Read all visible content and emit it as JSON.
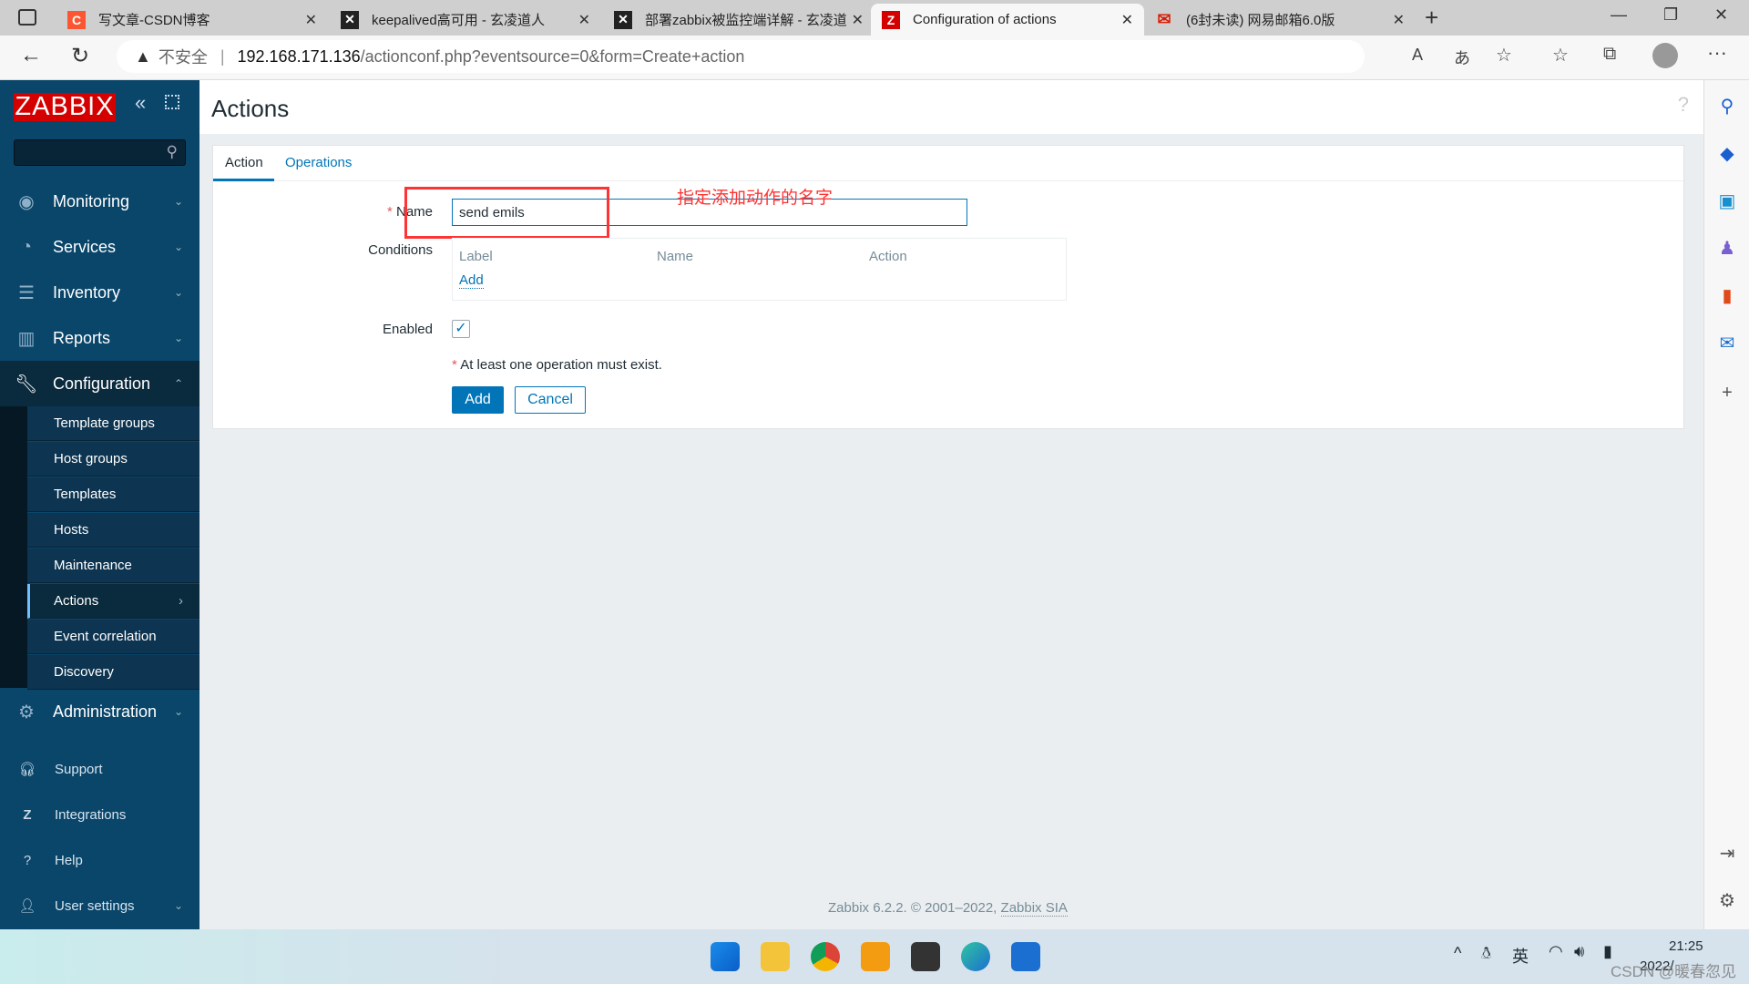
{
  "browser": {
    "tabs": [
      {
        "title": "写文章-CSDN博客",
        "icon": "csdn-icon",
        "color": "#fc5531"
      },
      {
        "title": "keepalived高可用 - 玄凌道人",
        "icon": "blog-icon",
        "color": "#222222"
      },
      {
        "title": "部署zabbix被监控端详解 - 玄凌道",
        "icon": "blog-icon",
        "color": "#222222"
      },
      {
        "title": "Configuration of actions",
        "icon": "zabbix-icon",
        "color": "#d40000"
      },
      {
        "title": "(6封未读) 网易邮箱6.0版",
        "icon": "netease-mail-icon",
        "color": "#d81e06"
      }
    ],
    "security_label": "不安全",
    "url_host": "192.168.171.136",
    "url_path": "/actionconf.php?eventsource=0&form=Create+action"
  },
  "sidebar": {
    "logo": "ZABBIX",
    "search_placeholder": "",
    "menu": [
      {
        "label": "Monitoring",
        "icon": "eye-icon"
      },
      {
        "label": "Services",
        "icon": "stopwatch-icon"
      },
      {
        "label": "Inventory",
        "icon": "list-icon"
      },
      {
        "label": "Reports",
        "icon": "bar-chart-icon"
      },
      {
        "label": "Configuration",
        "icon": "wrench-icon"
      }
    ],
    "config_sub": [
      "Template groups",
      "Host groups",
      "Templates",
      "Hosts",
      "Maintenance",
      "Actions",
      "Event correlation",
      "Discovery"
    ],
    "admin": {
      "label": "Administration",
      "icon": "gear-icon"
    },
    "bottom": [
      {
        "label": "Support",
        "icon": "headset-icon"
      },
      {
        "label": "Integrations",
        "icon": "z-icon"
      },
      {
        "label": "Help",
        "icon": "question-icon"
      },
      {
        "label": "User settings",
        "icon": "user-icon"
      }
    ]
  },
  "page": {
    "title": "Actions",
    "help": "?"
  },
  "form": {
    "tabs": [
      "Action",
      "Operations"
    ],
    "name_label": "Name",
    "name_value": "send emils",
    "annotation": "指定添加动作的名字",
    "conditions_label": "Conditions",
    "conditions_cols": [
      "Label",
      "Name",
      "Action"
    ],
    "conditions_add": "Add",
    "enabled_label": "Enabled",
    "enabled": true,
    "note": "At least one operation must exist.",
    "add_button": "Add",
    "cancel_button": "Cancel"
  },
  "footer": {
    "text": "Zabbix 6.2.2. © 2001–2022, ",
    "link": "Zabbix SIA"
  },
  "taskbar": {
    "ime": "英",
    "time": "21:25",
    "date": "2022/",
    "watermark": "CSDN @暖春忽见"
  },
  "colors": {
    "accent": "#0275b8",
    "sidebar": "#0a466a",
    "logo": "#d40000",
    "annotation": "#ff3333"
  }
}
